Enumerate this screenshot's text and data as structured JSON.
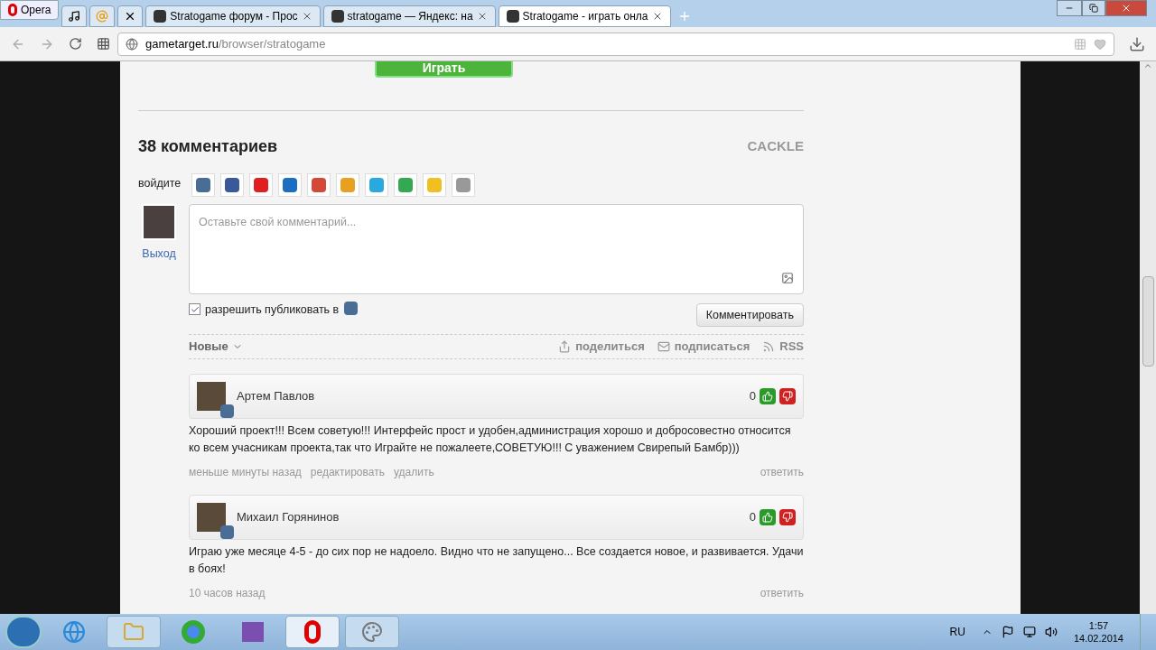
{
  "browser": {
    "menu_button": "Opera",
    "tabs": [
      {
        "title": "Stratogame форум - Прос",
        "selected": false
      },
      {
        "title": "stratogame — Яндекс: на",
        "selected": false
      },
      {
        "title": "Stratogame - играть онла",
        "selected": true
      }
    ],
    "address": {
      "host": "gametarget.ru",
      "path": "/browser/stratogame"
    }
  },
  "page": {
    "play_button": "Играть",
    "comments": {
      "heading": "38 комментариев",
      "brand": "CACKLE",
      "login_label": "войдите",
      "logout": "Выход",
      "placeholder": "Оставьте свой комментарий...",
      "publish": {
        "label": "разрешить публиковать в",
        "checked": true
      },
      "submit": "Комментировать",
      "sort": "Новые",
      "actions": [
        {
          "kind": "share",
          "label": "поделиться"
        },
        {
          "kind": "subscribe",
          "label": "подписаться"
        },
        {
          "kind": "rss",
          "label": "RSS"
        }
      ],
      "items": [
        {
          "author": "Артем Павлов",
          "score": "0",
          "text": "Хороший проект!!! Всем советую!!! Интерфейс прост и удобен,администрация хорошо и добросовестно относится ко всем учасникам проекта,так что Играйте не пожалеете,СОВЕТУЮ!!! С уважением Свирепый Бамбр)))",
          "time": "меньше минуты назад",
          "links": [
            "редактировать",
            "удалить"
          ],
          "reply": "ответить"
        },
        {
          "author": "Михаил Горянинов",
          "score": "0",
          "text": "Играю уже месяце 4-5 - до сих пор не надоело. Видно что не запущено... Все создается новое, и развивается. Удачи в боях!",
          "time": "10 часов назад",
          "reply": "ответить"
        }
      ]
    }
  },
  "taskbar": {
    "language": "RU",
    "time": "1:57",
    "date": "14.02.2014"
  }
}
